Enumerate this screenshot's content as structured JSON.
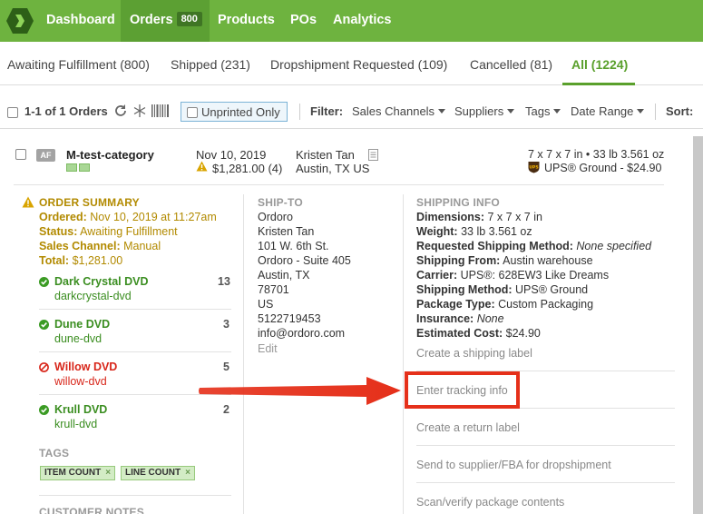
{
  "nav": {
    "items": [
      {
        "label": "Dashboard"
      },
      {
        "label": "Orders",
        "badge": "800"
      },
      {
        "label": "Products"
      },
      {
        "label": "POs"
      },
      {
        "label": "Analytics"
      }
    ]
  },
  "tabs": [
    {
      "label": "Awaiting Fulfillment (800)"
    },
    {
      "label": "Shipped (231)"
    },
    {
      "label": "Dropshipment Requested (109)"
    },
    {
      "label": "Cancelled (81)"
    },
    {
      "label": "All (1224)"
    }
  ],
  "toolbar": {
    "count_label": "1-1 of 1 Orders",
    "unprinted_label": "Unprinted Only",
    "filter_label": "Filter:",
    "filters": [
      "Sales Channels",
      "Suppliers",
      "Tags",
      "Date Range"
    ],
    "sort_label": "Sort:"
  },
  "order": {
    "status_badge": "AF",
    "id": "M-test-category",
    "date": "Nov 10, 2019",
    "total": "$1,281.00 (4)",
    "customer_name": "Kristen Tan",
    "customer_location": "Austin, TX US",
    "dims_weight": "7 x 7 x 7 in  •  33 lb  3.561 oz",
    "shipping": "UPS® Ground - $24.90",
    "ups_logo_text": "UPS"
  },
  "summary": {
    "title": "ORDER SUMMARY",
    "ordered_label": "Ordered:",
    "ordered_value": "Nov 10, 2019 at 11:27am",
    "status_label": "Status:",
    "status_value": "Awaiting Fulfillment",
    "channel_label": "Sales Channel:",
    "channel_value": "Manual",
    "total_label": "Total:",
    "total_value": "$1,281.00"
  },
  "lines": [
    {
      "name": "Dark Crystal DVD",
      "sku": "darkcrystal-dvd",
      "qty": "13",
      "status": "ok"
    },
    {
      "name": "Dune DVD",
      "sku": "dune-dvd",
      "qty": "3",
      "status": "ok"
    },
    {
      "name": "Willow DVD",
      "sku": "willow-dvd",
      "qty": "5",
      "status": "error"
    },
    {
      "name": "Krull DVD",
      "sku": "krull-dvd",
      "qty": "2",
      "status": "ok"
    }
  ],
  "tags": {
    "title": "TAGS",
    "items": [
      "ITEM COUNT",
      "LINE COUNT"
    ]
  },
  "notes_title": "CUSTOMER NOTES",
  "ship_to": {
    "title": "SHIP-TO",
    "lines": [
      "Ordoro",
      "Kristen Tan",
      "101 W. 6th St.",
      "Ordoro - Suite 405",
      "Austin, TX",
      "78701",
      "US",
      "5122719453",
      "info@ordoro.com"
    ],
    "edit_label": "Edit"
  },
  "shipping_info": {
    "title": "SHIPPING INFO",
    "dimensions_label": "Dimensions:",
    "dimensions_value": "7 x 7 x 7 in",
    "weight_label": "Weight:",
    "weight_value": "33 lb  3.561 oz",
    "requested_label": "Requested Shipping Method:",
    "requested_value": "None specified",
    "from_label": "Shipping From:",
    "from_value": "Austin warehouse",
    "carrier_label": "Carrier:",
    "carrier_value": "UPS®: 628EW3 Like Dreams",
    "method_label": "Shipping Method:",
    "method_value": "UPS® Ground",
    "package_label": "Package Type:",
    "package_value": "Custom Packaging",
    "insurance_label": "Insurance:",
    "insurance_value": "None",
    "cost_label": "Estimated Cost:",
    "cost_value": "$24.90"
  },
  "actions": [
    {
      "label": "Create a shipping label"
    },
    {
      "label": "Enter tracking info"
    },
    {
      "label": "Create a return label"
    },
    {
      "label": "Send to supplier/FBA for dropshipment"
    },
    {
      "label": "Scan/verify package contents"
    }
  ],
  "colors": {
    "brand_green": "#6eb33f",
    "accent_green": "#5aa02c",
    "warning": "#b28a00",
    "error": "#d8261a",
    "callout_red": "#e5301a"
  }
}
